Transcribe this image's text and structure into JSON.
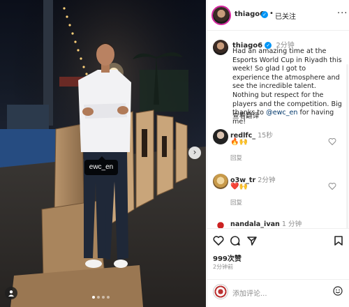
{
  "photo": {
    "tag": "ewc_en",
    "dots_count": 4,
    "active_dot": 0
  },
  "header": {
    "username": "thiago6",
    "separator": "•",
    "follow_label": "已关注",
    "more_label": "···"
  },
  "caption": {
    "username": "thiago6",
    "time": "2分钟",
    "text_before_mention": "Had an amazing time at the Esports World Cup in Riyadh this week! So glad I got to experience the atmosphere and see the incredible talent. Nothing but respect for the players and the competition. Big thanks to ",
    "mention": "@ewc_en",
    "text_after_mention": " for having me!",
    "translate_label": "查看翻译"
  },
  "comments": [
    {
      "username": "redlfc_",
      "time": "15秒",
      "emoji": "🔥🙌",
      "reply_label": "回复"
    },
    {
      "username": "o3w_tr",
      "time": "2分钟",
      "emoji": "❤️🙌",
      "reply_label": "回复"
    },
    {
      "username": "nandala_ivan",
      "time": "1 分钟",
      "emoji": "",
      "reply_label": ""
    }
  ],
  "actions": {
    "likes": "999次赞",
    "posted": "2分钟前"
  },
  "add_comment": {
    "placeholder": "添加评论..."
  },
  "colors": {
    "verified": "#0095f6",
    "link": "#00376b",
    "muted": "#8e8e8e"
  }
}
